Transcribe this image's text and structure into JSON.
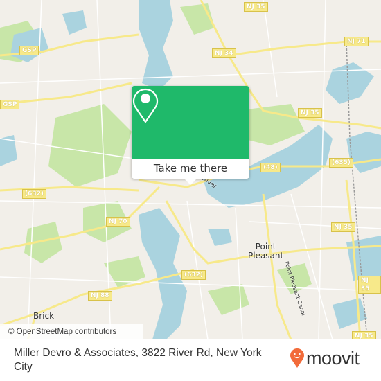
{
  "map": {
    "colors": {
      "land": "#f2efe9",
      "water": "#aad3df",
      "park": "#c8e6a8",
      "road": "#f7e98a",
      "accent": "#1fb96a",
      "brand": "#f26b3a"
    },
    "shields": [
      {
        "label": "GSP",
        "style": "yellow"
      },
      {
        "label": "GSP",
        "style": "yellow"
      },
      {
        "label": "NJ 34",
        "style": "yellow"
      },
      {
        "label": "NJ 35",
        "style": "yellow"
      },
      {
        "label": "NJ 71",
        "style": "yellow"
      },
      {
        "label": "NJ 35",
        "style": "yellow"
      },
      {
        "label": "(48)",
        "style": "yellow"
      },
      {
        "label": "(635)",
        "style": "yellow"
      },
      {
        "label": "(632)",
        "style": "yellow"
      },
      {
        "label": "NJ 70",
        "style": "yellow"
      },
      {
        "label": "NJ 35",
        "style": "yellow"
      },
      {
        "label": "(632)",
        "style": "yellow"
      },
      {
        "label": "NJ 88",
        "style": "yellow"
      },
      {
        "label": "NJ 35",
        "style": "yellow"
      },
      {
        "label": "NJ 35",
        "style": "yellow"
      }
    ],
    "places": {
      "point_pleasant": "Point\nPleasant",
      "brick": "Brick",
      "river": "River",
      "canal": "Point Pleasant Canal"
    },
    "attribution": "© OpenStreetMap contributors"
  },
  "popup": {
    "icon": "map-pin-icon",
    "button_label": "Take me there"
  },
  "footer": {
    "address": "Miller Devro & Associates, 3822 River Rd, New York City",
    "logo_text": "moovit",
    "logo_icon": "moovit-pin-icon"
  }
}
